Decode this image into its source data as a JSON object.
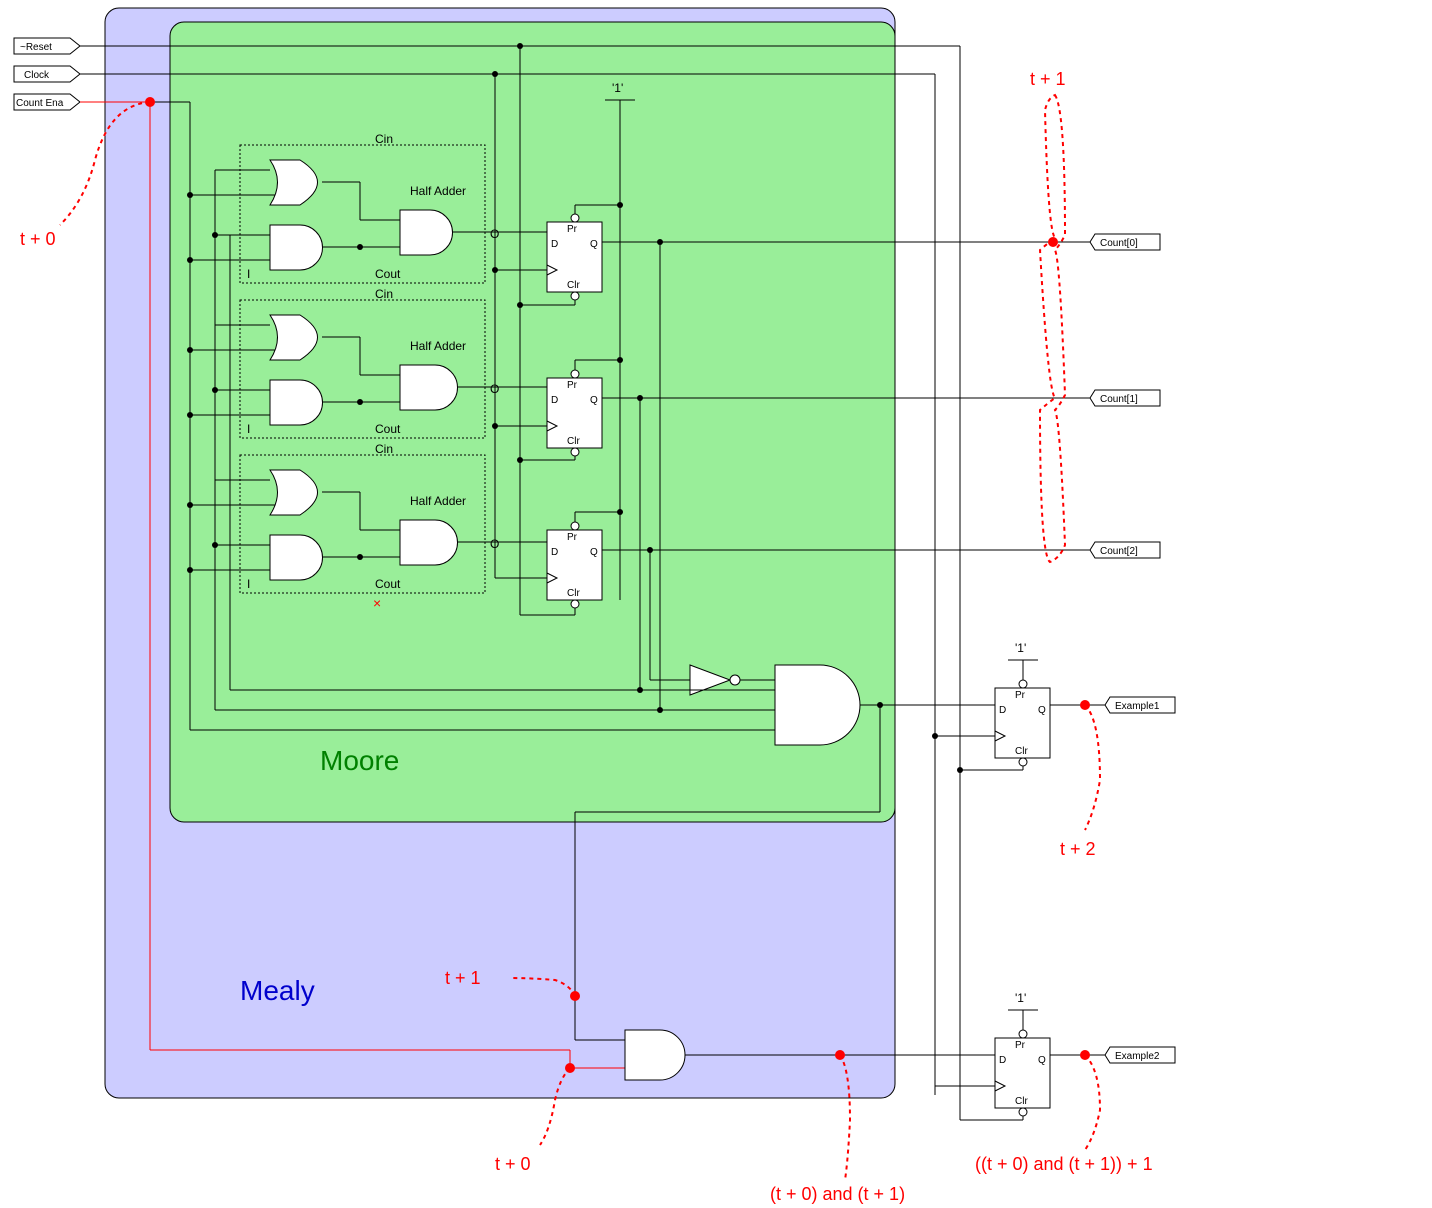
{
  "inputs": {
    "reset": "~Reset",
    "clock": "Clock",
    "count_ena": "Count Ena"
  },
  "outputs": {
    "count0": "Count[0]",
    "count1": "Count[1]",
    "count2": "Count[2]",
    "example1": "Example1",
    "example2": "Example2"
  },
  "labels": {
    "half_adder": "Half Adder",
    "cin": "Cin",
    "cout": "Cout",
    "i": "I",
    "o": "O",
    "pr": "Pr",
    "clr": "Clr",
    "d": "D",
    "q": "Q",
    "one": "'1'",
    "moore": "Moore",
    "mealy": "Mealy"
  },
  "annotations": {
    "t0": "t + 0",
    "t1": "t + 1",
    "t2": "t + 2",
    "t0_bottom": "t + 0",
    "t1_mid": "t + 1",
    "expr_and": "(t + 0) and (t + 1)",
    "expr_full": "((t + 0) and (t + 1)) + 1"
  }
}
